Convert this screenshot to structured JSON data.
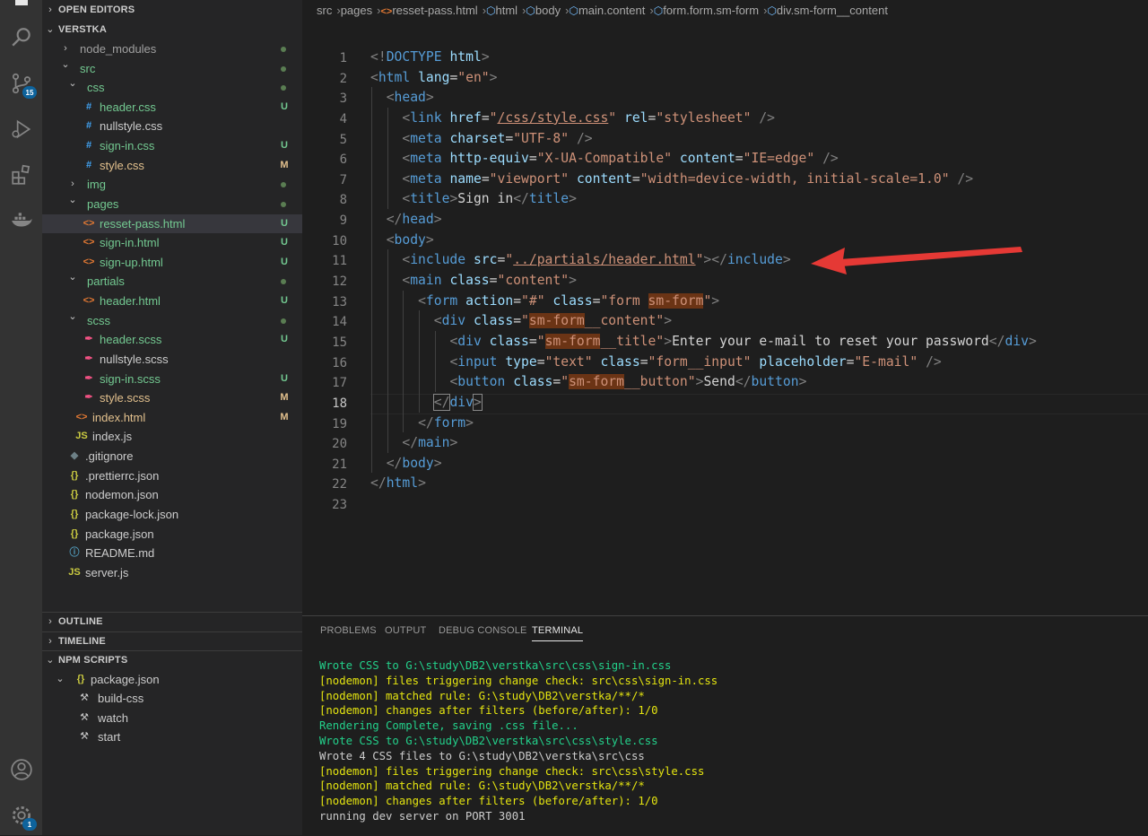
{
  "activity_bar": {
    "items": [
      {
        "icon": "files-icon"
      },
      {
        "icon": "search-icon"
      },
      {
        "icon": "source-control-icon",
        "badge": "15"
      },
      {
        "icon": "run-debug-icon"
      },
      {
        "icon": "extensions-icon"
      },
      {
        "icon": "docker-icon"
      }
    ],
    "bottom": [
      {
        "icon": "accounts-icon"
      },
      {
        "icon": "manage-gear-icon",
        "badge": "1"
      }
    ]
  },
  "explorer": {
    "open_editors_label": "OPEN EDITORS",
    "project_label": "VERSTKA",
    "tree": [
      {
        "label": "node_modules",
        "kind": "folder",
        "open": false,
        "depth": 1,
        "status": "dot",
        "dim": true
      },
      {
        "label": "src",
        "kind": "folder",
        "open": true,
        "depth": 1,
        "status": "dot",
        "color": "u"
      },
      {
        "label": "css",
        "kind": "folder",
        "open": true,
        "depth": 2,
        "status": "dot",
        "color": "u"
      },
      {
        "label": "header.css",
        "kind": "css",
        "depth": 3,
        "status": "U",
        "color": "u"
      },
      {
        "label": "nullstyle.css",
        "kind": "css",
        "depth": 3,
        "status": "",
        "color": "def"
      },
      {
        "label": "sign-in.css",
        "kind": "css",
        "depth": 3,
        "status": "U",
        "color": "u"
      },
      {
        "label": "style.css",
        "kind": "css",
        "depth": 3,
        "status": "M",
        "color": "m"
      },
      {
        "label": "img",
        "kind": "folder",
        "open": false,
        "depth": 2,
        "status": "dot",
        "color": "u"
      },
      {
        "label": "pages",
        "kind": "folder",
        "open": true,
        "depth": 2,
        "status": "dot",
        "color": "u"
      },
      {
        "label": "resset-pass.html",
        "kind": "html",
        "depth": 3,
        "status": "U",
        "color": "u",
        "selected": true
      },
      {
        "label": "sign-in.html",
        "kind": "html",
        "depth": 3,
        "status": "U",
        "color": "u"
      },
      {
        "label": "sign-up.html",
        "kind": "html",
        "depth": 3,
        "status": "U",
        "color": "u"
      },
      {
        "label": "partials",
        "kind": "folder",
        "open": true,
        "depth": 2,
        "status": "dot",
        "color": "u"
      },
      {
        "label": "header.html",
        "kind": "html",
        "depth": 3,
        "status": "U",
        "color": "u"
      },
      {
        "label": "scss",
        "kind": "folder",
        "open": true,
        "depth": 2,
        "status": "dot",
        "color": "u"
      },
      {
        "label": "header.scss",
        "kind": "scss",
        "depth": 3,
        "status": "U",
        "color": "u"
      },
      {
        "label": "nullstyle.scss",
        "kind": "scss",
        "depth": 3,
        "status": "",
        "color": "def"
      },
      {
        "label": "sign-in.scss",
        "kind": "scss",
        "depth": 3,
        "status": "U",
        "color": "u"
      },
      {
        "label": "style.scss",
        "kind": "scss",
        "depth": 3,
        "status": "M",
        "color": "m"
      },
      {
        "label": "index.html",
        "kind": "html",
        "depth": 2,
        "status": "M",
        "color": "m"
      },
      {
        "label": "index.js",
        "kind": "js",
        "depth": 2,
        "status": "",
        "color": "def"
      },
      {
        "label": ".gitignore",
        "kind": "git",
        "depth": 1,
        "status": "",
        "color": "def"
      },
      {
        "label": ".prettierrc.json",
        "kind": "json",
        "depth": 1,
        "status": "",
        "color": "def"
      },
      {
        "label": "nodemon.json",
        "kind": "json",
        "depth": 1,
        "status": "",
        "color": "def"
      },
      {
        "label": "package-lock.json",
        "kind": "json",
        "depth": 1,
        "status": "",
        "color": "def"
      },
      {
        "label": "package.json",
        "kind": "json",
        "depth": 1,
        "status": "",
        "color": "def"
      },
      {
        "label": "README.md",
        "kind": "info",
        "depth": 1,
        "status": "",
        "color": "def"
      },
      {
        "label": "server.js",
        "kind": "js",
        "depth": 1,
        "status": "",
        "color": "def"
      }
    ],
    "outline_label": "OUTLINE",
    "timeline_label": "TIMELINE",
    "npm_label": "NPM SCRIPTS",
    "npm_package": "package.json",
    "npm_scripts": [
      "build-css",
      "watch",
      "start"
    ]
  },
  "breadcrumb": [
    "src",
    "pages",
    "resset-pass.html",
    "html",
    "body",
    "main.content",
    "form.form.sm-form",
    "div.sm-form__content"
  ],
  "editor": {
    "current_line": 18,
    "lines": [
      {
        "n": 1,
        "indent": 0,
        "toks": [
          [
            "p",
            "<!"
          ],
          [
            "t",
            "DOCTYPE"
          ],
          [
            "x",
            " "
          ],
          [
            "a",
            "html"
          ],
          [
            "p",
            ">"
          ]
        ]
      },
      {
        "n": 2,
        "indent": 0,
        "toks": [
          [
            "p",
            "<"
          ],
          [
            "t",
            "html"
          ],
          [
            "x",
            " "
          ],
          [
            "a",
            "lang"
          ],
          [
            "x",
            "="
          ],
          [
            "s",
            "\"en\""
          ],
          [
            "p",
            ">"
          ]
        ]
      },
      {
        "n": 3,
        "indent": 1,
        "toks": [
          [
            "p",
            "<"
          ],
          [
            "t",
            "head"
          ],
          [
            "p",
            ">"
          ]
        ]
      },
      {
        "n": 4,
        "indent": 2,
        "toks": [
          [
            "p",
            "<"
          ],
          [
            "t",
            "link"
          ],
          [
            "x",
            " "
          ],
          [
            "a",
            "href"
          ],
          [
            "x",
            "="
          ],
          [
            "s",
            "\""
          ],
          [
            "su",
            "/css/style.css"
          ],
          [
            "s",
            "\""
          ],
          [
            "x",
            " "
          ],
          [
            "a",
            "rel"
          ],
          [
            "x",
            "="
          ],
          [
            "s",
            "\"stylesheet\""
          ],
          [
            "x",
            " "
          ],
          [
            "p",
            "/>"
          ]
        ]
      },
      {
        "n": 5,
        "indent": 2,
        "toks": [
          [
            "p",
            "<"
          ],
          [
            "t",
            "meta"
          ],
          [
            "x",
            " "
          ],
          [
            "a",
            "charset"
          ],
          [
            "x",
            "="
          ],
          [
            "s",
            "\"UTF-8\""
          ],
          [
            "x",
            " "
          ],
          [
            "p",
            "/>"
          ]
        ]
      },
      {
        "n": 6,
        "indent": 2,
        "toks": [
          [
            "p",
            "<"
          ],
          [
            "t",
            "meta"
          ],
          [
            "x",
            " "
          ],
          [
            "a",
            "http-equiv"
          ],
          [
            "x",
            "="
          ],
          [
            "s",
            "\"X-UA-Compatible\""
          ],
          [
            "x",
            " "
          ],
          [
            "a",
            "content"
          ],
          [
            "x",
            "="
          ],
          [
            "s",
            "\"IE=edge\""
          ],
          [
            "x",
            " "
          ],
          [
            "p",
            "/>"
          ]
        ]
      },
      {
        "n": 7,
        "indent": 2,
        "toks": [
          [
            "p",
            "<"
          ],
          [
            "t",
            "meta"
          ],
          [
            "x",
            " "
          ],
          [
            "a",
            "name"
          ],
          [
            "x",
            "="
          ],
          [
            "s",
            "\"viewport\""
          ],
          [
            "x",
            " "
          ],
          [
            "a",
            "content"
          ],
          [
            "x",
            "="
          ],
          [
            "s",
            "\"width=device-width, initial-scale=1.0\""
          ],
          [
            "x",
            " "
          ],
          [
            "p",
            "/>"
          ]
        ]
      },
      {
        "n": 8,
        "indent": 2,
        "toks": [
          [
            "p",
            "<"
          ],
          [
            "t",
            "title"
          ],
          [
            "p",
            ">"
          ],
          [
            "x",
            "Sign in"
          ],
          [
            "p",
            "</"
          ],
          [
            "t",
            "title"
          ],
          [
            "p",
            ">"
          ]
        ]
      },
      {
        "n": 9,
        "indent": 1,
        "toks": [
          [
            "p",
            "</"
          ],
          [
            "t",
            "head"
          ],
          [
            "p",
            ">"
          ]
        ]
      },
      {
        "n": 10,
        "indent": 1,
        "toks": [
          [
            "p",
            "<"
          ],
          [
            "t",
            "body"
          ],
          [
            "p",
            ">"
          ]
        ]
      },
      {
        "n": 11,
        "indent": 2,
        "toks": [
          [
            "p",
            "<"
          ],
          [
            "t",
            "include"
          ],
          [
            "x",
            " "
          ],
          [
            "a",
            "src"
          ],
          [
            "x",
            "="
          ],
          [
            "s",
            "\""
          ],
          [
            "su",
            "../partials/header.html"
          ],
          [
            "s",
            "\""
          ],
          [
            "p",
            "></"
          ],
          [
            "t",
            "include"
          ],
          [
            "p",
            ">"
          ]
        ]
      },
      {
        "n": 12,
        "indent": 2,
        "toks": [
          [
            "p",
            "<"
          ],
          [
            "t",
            "main"
          ],
          [
            "x",
            " "
          ],
          [
            "a",
            "class"
          ],
          [
            "x",
            "="
          ],
          [
            "s",
            "\"content\""
          ],
          [
            "p",
            ">"
          ]
        ]
      },
      {
        "n": 13,
        "indent": 3,
        "toks": [
          [
            "p",
            "<"
          ],
          [
            "t",
            "form"
          ],
          [
            "x",
            " "
          ],
          [
            "a",
            "action"
          ],
          [
            "x",
            "="
          ],
          [
            "s",
            "\"#\""
          ],
          [
            "x",
            " "
          ],
          [
            "a",
            "class"
          ],
          [
            "x",
            "="
          ],
          [
            "s",
            "\"form "
          ],
          [
            "sh",
            "sm-form"
          ],
          [
            "s",
            "\""
          ],
          [
            "p",
            ">"
          ]
        ]
      },
      {
        "n": 14,
        "indent": 4,
        "toks": [
          [
            "p",
            "<"
          ],
          [
            "t",
            "div"
          ],
          [
            "x",
            " "
          ],
          [
            "a",
            "class"
          ],
          [
            "x",
            "="
          ],
          [
            "s",
            "\""
          ],
          [
            "sh",
            "sm-form"
          ],
          [
            "s",
            "__content\""
          ],
          [
            "p",
            ">"
          ]
        ]
      },
      {
        "n": 15,
        "indent": 5,
        "toks": [
          [
            "p",
            "<"
          ],
          [
            "t",
            "div"
          ],
          [
            "x",
            " "
          ],
          [
            "a",
            "class"
          ],
          [
            "x",
            "="
          ],
          [
            "s",
            "\""
          ],
          [
            "sh",
            "sm-form"
          ],
          [
            "s",
            "__title\""
          ],
          [
            "p",
            ">"
          ],
          [
            "x",
            "Enter your e-mail to reset your password"
          ],
          [
            "p",
            "</"
          ],
          [
            "t",
            "div"
          ],
          [
            "p",
            ">"
          ]
        ]
      },
      {
        "n": 16,
        "indent": 5,
        "toks": [
          [
            "p",
            "<"
          ],
          [
            "t",
            "input"
          ],
          [
            "x",
            " "
          ],
          [
            "a",
            "type"
          ],
          [
            "x",
            "="
          ],
          [
            "s",
            "\"text\""
          ],
          [
            "x",
            " "
          ],
          [
            "a",
            "class"
          ],
          [
            "x",
            "="
          ],
          [
            "s",
            "\"form__input\""
          ],
          [
            "x",
            " "
          ],
          [
            "a",
            "placeholder"
          ],
          [
            "x",
            "="
          ],
          [
            "s",
            "\"E-mail\""
          ],
          [
            "x",
            " "
          ],
          [
            "p",
            "/>"
          ]
        ]
      },
      {
        "n": 17,
        "indent": 5,
        "toks": [
          [
            "p",
            "<"
          ],
          [
            "t",
            "button"
          ],
          [
            "x",
            " "
          ],
          [
            "a",
            "class"
          ],
          [
            "x",
            "="
          ],
          [
            "s",
            "\""
          ],
          [
            "sh",
            "sm-form"
          ],
          [
            "s",
            "__button\""
          ],
          [
            "p",
            ">"
          ],
          [
            "x",
            "Send"
          ],
          [
            "p",
            "</"
          ],
          [
            "t",
            "button"
          ],
          [
            "p",
            ">"
          ]
        ]
      },
      {
        "n": 18,
        "indent": 4,
        "toks": [
          [
            "p",
            "</"
          ],
          [
            "t",
            "div"
          ],
          [
            "p",
            ">"
          ]
        ]
      },
      {
        "n": 19,
        "indent": 3,
        "toks": [
          [
            "p",
            "</"
          ],
          [
            "t",
            "form"
          ],
          [
            "p",
            ">"
          ]
        ]
      },
      {
        "n": 20,
        "indent": 2,
        "toks": [
          [
            "p",
            "</"
          ],
          [
            "t",
            "main"
          ],
          [
            "p",
            ">"
          ]
        ]
      },
      {
        "n": 21,
        "indent": 1,
        "toks": [
          [
            "p",
            "</"
          ],
          [
            "t",
            "body"
          ],
          [
            "p",
            ">"
          ]
        ]
      },
      {
        "n": 22,
        "indent": 0,
        "toks": [
          [
            "p",
            "</"
          ],
          [
            "t",
            "html"
          ],
          [
            "p",
            ">"
          ]
        ]
      },
      {
        "n": 23,
        "indent": 0,
        "toks": []
      }
    ]
  },
  "panel": {
    "tabs": [
      "PROBLEMS",
      "OUTPUT",
      "DEBUG CONSOLE",
      "TERMINAL"
    ],
    "active_tab": "TERMINAL",
    "terminal_lines": [
      {
        "c": "g",
        "text": "Wrote CSS to G:\\study\\DB2\\verstka\\src\\css\\sign-in.css"
      },
      {
        "c": "y",
        "text": "[nodemon] files triggering change check: src\\css\\sign-in.css"
      },
      {
        "c": "y",
        "text": "[nodemon] matched rule: G:\\study\\DB2\\verstka/**/*"
      },
      {
        "c": "y",
        "text": "[nodemon] changes after filters (before/after): 1/0"
      },
      {
        "c": "g",
        "text": "Rendering Complete, saving .css file..."
      },
      {
        "c": "g",
        "text": "Wrote CSS to G:\\study\\DB2\\verstka\\src\\css\\style.css"
      },
      {
        "c": "w",
        "text": "Wrote 4 CSS files to G:\\study\\DB2\\verstka\\src\\css"
      },
      {
        "c": "y",
        "text": "[nodemon] files triggering change check: src\\css\\style.css"
      },
      {
        "c": "y",
        "text": "[nodemon] matched rule: G:\\study\\DB2\\verstka/**/*"
      },
      {
        "c": "y",
        "text": "[nodemon] changes after filters (before/after): 1/0"
      },
      {
        "c": "w",
        "text": "running dev server on PORT 3001"
      }
    ]
  },
  "colors": {
    "status_untracked": "#73c991",
    "status_modified": "#e2c08d",
    "annotation_arrow": "#e53935",
    "terminal_green": "#23d18b",
    "terminal_yellow": "#e5e510"
  }
}
